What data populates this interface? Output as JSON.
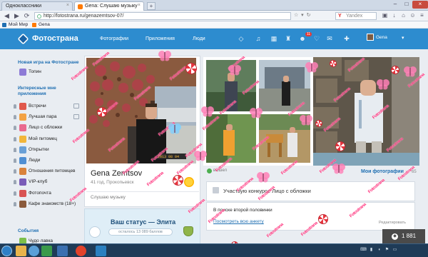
{
  "browser": {
    "tabs": [
      {
        "label": "Одноклассники"
      },
      {
        "label": "Gena: Слушаю музыку"
      }
    ],
    "url": "http://fotostrana.ru/genazemtsov-07/",
    "search_placeholder": "Yandex",
    "bookmarks": [
      {
        "label": "Мой Мир"
      },
      {
        "label": "Gena"
      }
    ]
  },
  "header": {
    "logo": "Фотострана",
    "nav": [
      "Фотографии",
      "Приложения",
      "Люди"
    ],
    "notification_count": "11",
    "user_name": "Gena"
  },
  "sidebar": {
    "section1_title": "Новая игра на Фотостране",
    "game_item": "Топин",
    "section2_title": "Интересные мне приложения",
    "items": [
      {
        "label": "Встречи",
        "color": "#e0584c"
      },
      {
        "label": "Лучшая пара",
        "color": "#f3a243"
      },
      {
        "label": "Лицо с обложки",
        "color": "#e96a8f"
      },
      {
        "label": "Мой питомец",
        "color": "#f2b63a"
      },
      {
        "label": "Открытки",
        "color": "#6aa0d6"
      },
      {
        "label": "Люди",
        "color": "#4f8fd3"
      },
      {
        "label": "Отношения питомцев",
        "color": "#d9823b"
      },
      {
        "label": "VIP-клуб",
        "color": "#7a5cb8"
      },
      {
        "label": "Фотопочта",
        "color": "#d95353"
      },
      {
        "label": "Кафе знакомств (18+)",
        "color": "#8a5a3b"
      }
    ],
    "section3_title": "События",
    "last_item": "Чудо лавка"
  },
  "profile": {
    "name": "Gena Zemtsov",
    "meta": "41 год, Прокопьевск",
    "music": "Слушаю музыку",
    "photo_stamp": "2013 08 04",
    "status_title": "Ваш статус — Элита",
    "status_points": "осталось 13 089 баллов"
  },
  "photos": {
    "online_label": "вышел",
    "my_photos_link": "Мои фотографии",
    "my_photos_count": "65"
  },
  "contest": {
    "text": "Участвую конкурсе Лицо с обложки"
  },
  "ad": {
    "title": "В поиске второй половинки",
    "link": "Посмотреть всю анкету",
    "edit": "Редактировать"
  },
  "rating": {
    "value": "1 881"
  },
  "stickers": {
    "stamp_text": "Fotostrana"
  },
  "colors": {
    "header_blue": "#2d8ccf",
    "link_blue": "#1f6fb2",
    "sticker_pink": "#ff2e7a"
  }
}
